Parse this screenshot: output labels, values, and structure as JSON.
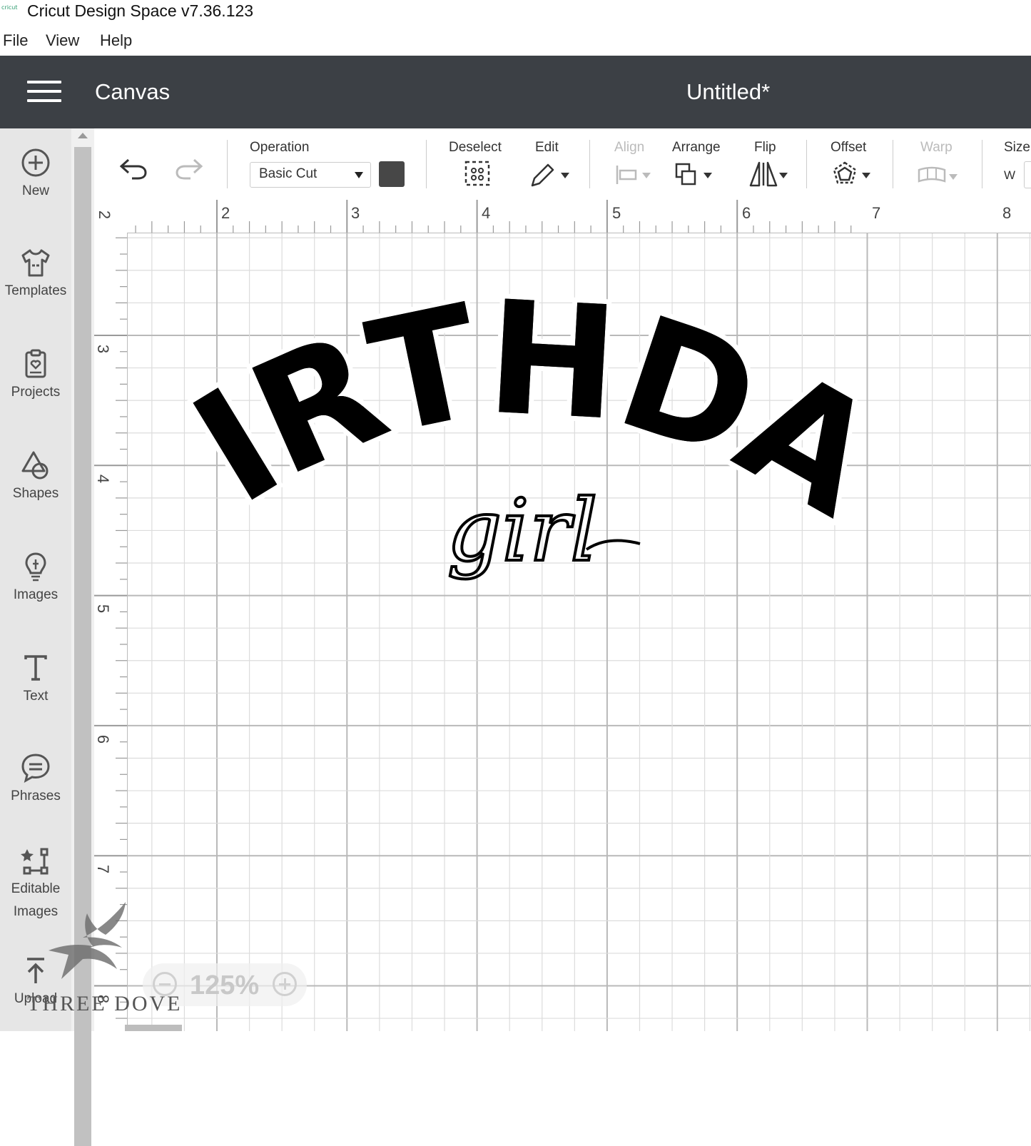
{
  "window": {
    "title": "Cricut Design Space  v7.36.123",
    "app_icon_text": "cricut"
  },
  "menu": [
    "File",
    "View",
    "Help"
  ],
  "header": {
    "section": "Canvas",
    "document_title": "Untitled*"
  },
  "sidebar": [
    {
      "label": "New",
      "icon": "plus-circle-icon"
    },
    {
      "label": "Templates",
      "icon": "tshirt-icon"
    },
    {
      "label": "Projects",
      "icon": "project-icon"
    },
    {
      "label": "Shapes",
      "icon": "shapes-icon"
    },
    {
      "label": "Images",
      "icon": "lightbulb-icon"
    },
    {
      "label": "Text",
      "icon": "text-icon"
    },
    {
      "label": "Phrases",
      "icon": "speech-bubble-icon"
    },
    {
      "label": "Editable Images",
      "icon": "editable-images-icon"
    },
    {
      "label": "Upload",
      "icon": "upload-icon"
    }
  ],
  "toolbar": {
    "operation_label": "Operation",
    "operation_value": "Basic Cut",
    "operation_color": "#474747",
    "deselect": "Deselect",
    "edit": "Edit",
    "align": "Align",
    "arrange": "Arrange",
    "flip": "Flip",
    "offset": "Offset",
    "warp": "Warp",
    "size": "Size",
    "size_w": "W"
  },
  "ruler": {
    "top": [
      "2",
      "2",
      "3",
      "4",
      "5",
      "6",
      "7",
      "8"
    ],
    "left": [
      "3",
      "4",
      "5",
      "6",
      "7",
      "8"
    ]
  },
  "design": {
    "line1": "BIRTHDAY",
    "line2": "girl"
  },
  "zoom": {
    "value": "125%"
  },
  "watermark": "THREE DOVE"
}
